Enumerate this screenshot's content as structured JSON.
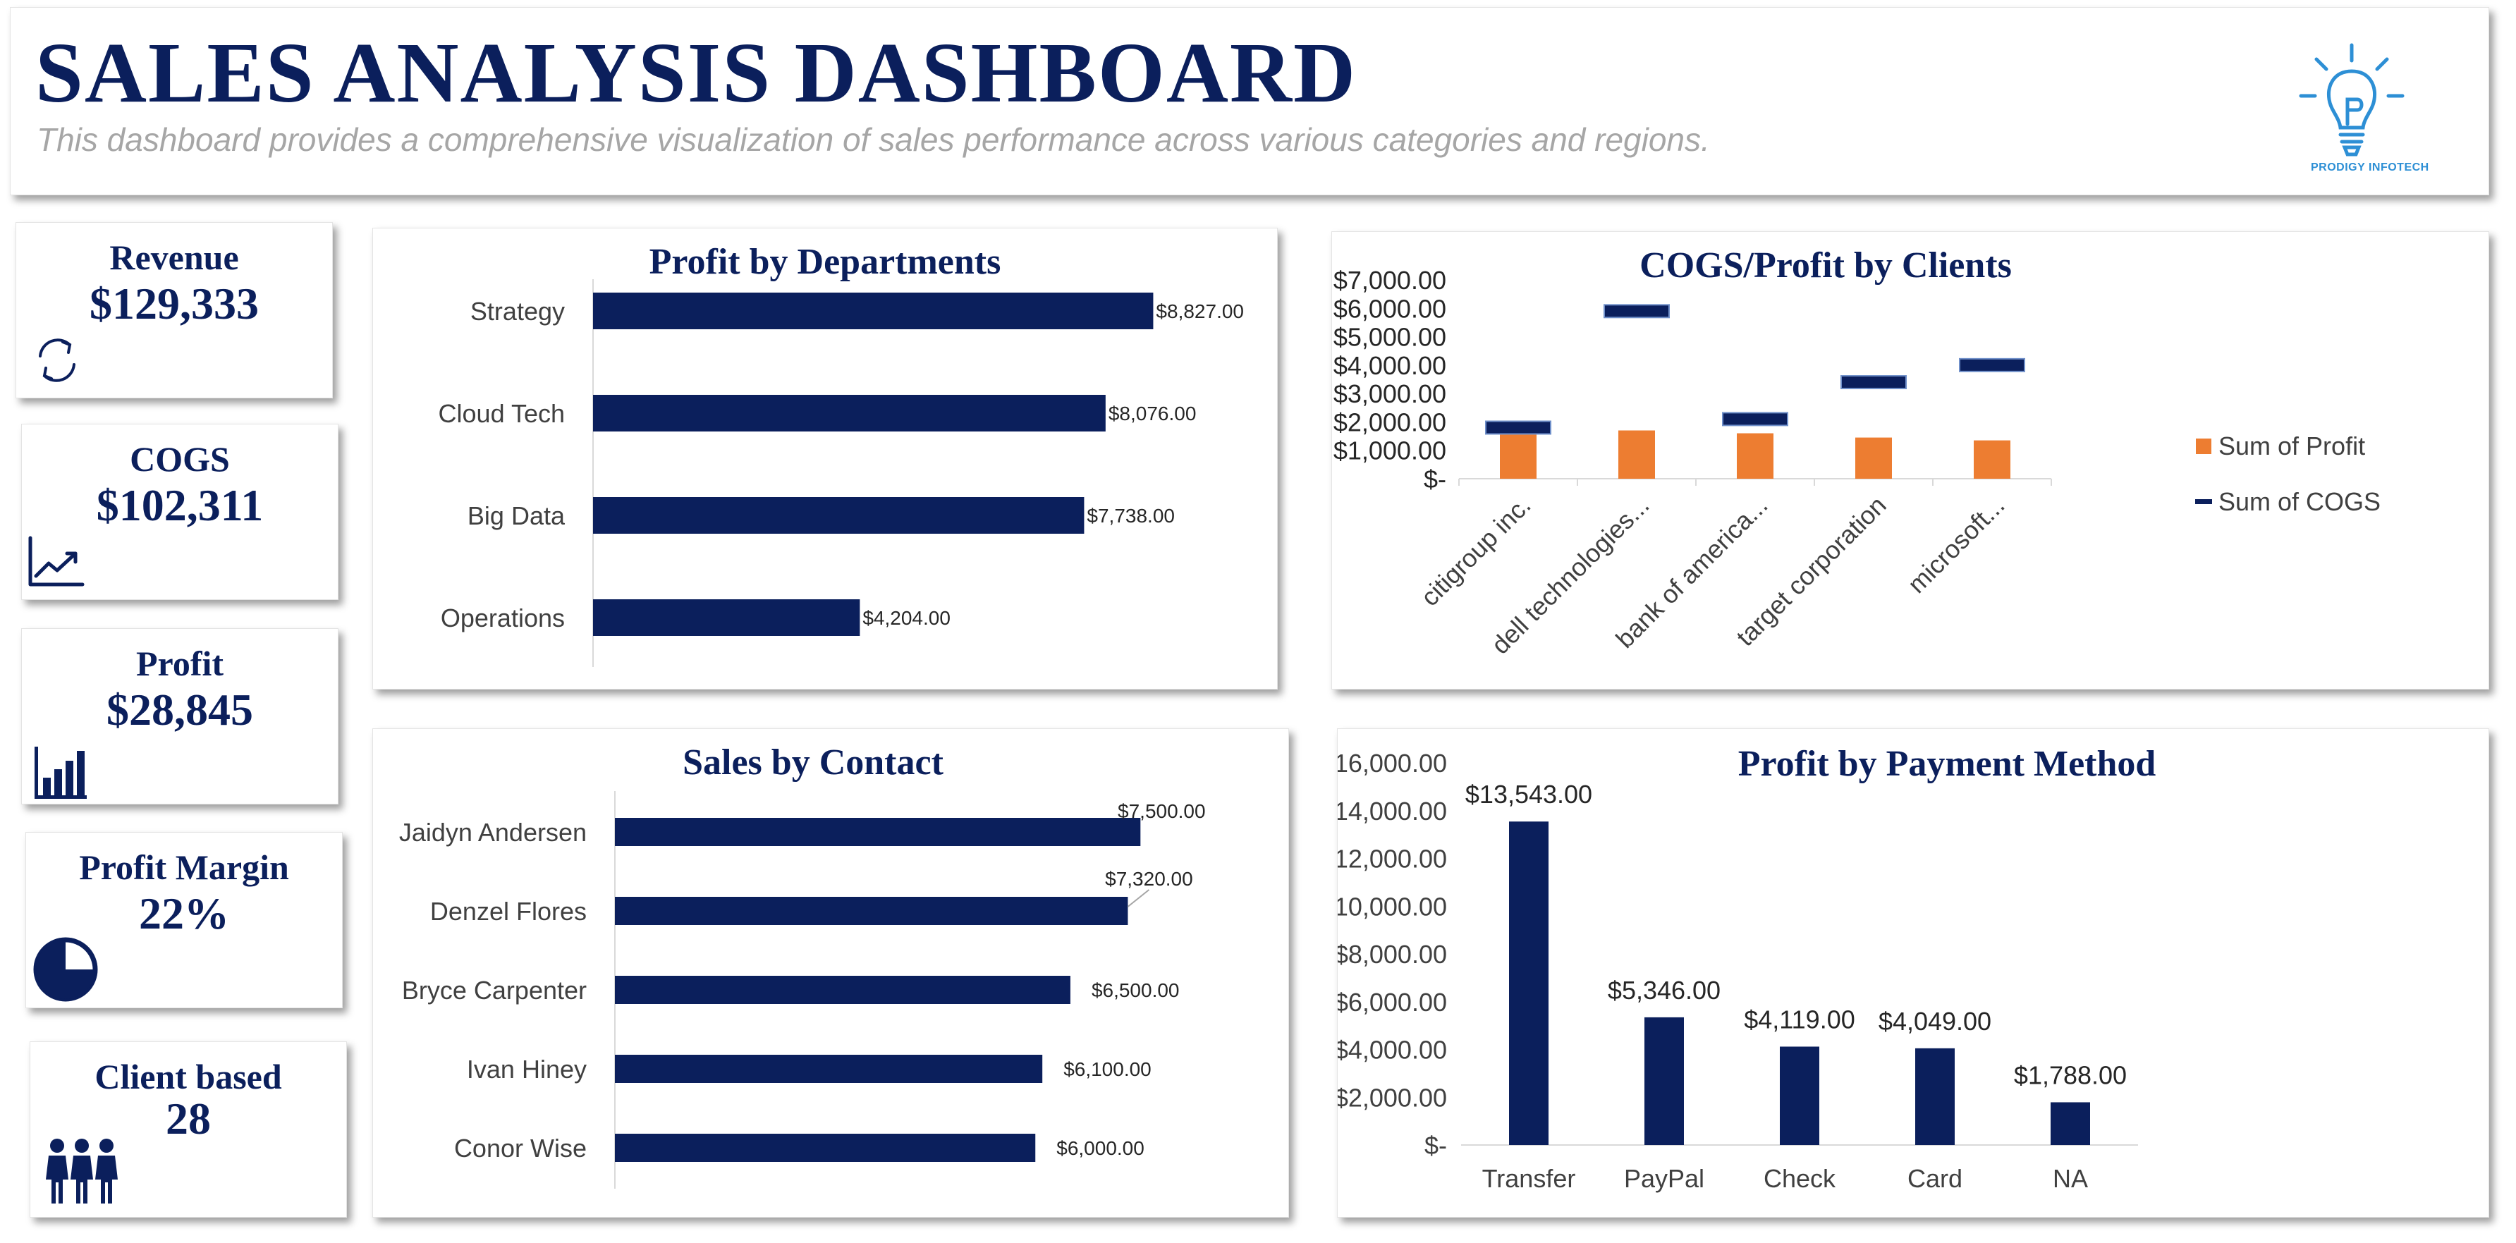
{
  "header": {
    "title": "SALES ANALYSIS DASHBOARD",
    "subtitle": "This dashboard provides a comprehensive visualization of sales performance across various categories and regions.",
    "logo_text": "PRODIGY INFOTECH"
  },
  "kpis": [
    {
      "label": "Revenue",
      "value": "$129,333",
      "icon": "refresh-icon"
    },
    {
      "label": "COGS",
      "value": "$102,311",
      "icon": "trend-up-icon"
    },
    {
      "label": "Profit",
      "value": "$28,845",
      "icon": "bar-chart-icon"
    },
    {
      "label": "Profit Margin",
      "value": "22%",
      "icon": "pie-icon"
    },
    {
      "label": "Client based",
      "value": "28",
      "icon": "people-icon"
    }
  ],
  "colors": {
    "navy": "#0b1f5c",
    "orange": "#ed7d31",
    "grey_text": "#a6a6a6"
  },
  "chart_data": [
    {
      "id": "departments",
      "type": "bar",
      "orientation": "horizontal",
      "title": "Profit by Departments",
      "categories": [
        "Strategy",
        "Cloud Tech",
        "Big Data",
        "Operations"
      ],
      "values": [
        8827,
        8076,
        7738,
        4204
      ],
      "labels": [
        "$8,827.00",
        "$8,076.00",
        "$7,738.00",
        "$4,204.00"
      ],
      "xlim": [
        0,
        9000
      ],
      "color": "#0b1f5c"
    },
    {
      "id": "clients",
      "type": "bar",
      "title": "COGS/Profit by Clients",
      "categories": [
        "citigroup inc.",
        "dell technologies...",
        "bank of america...",
        "target corporation",
        "microsoft..."
      ],
      "series": [
        {
          "name": "Sum of Profit",
          "values": [
            1650,
            1700,
            1600,
            1450,
            1350
          ],
          "color": "#ed7d31",
          "mark": "bar"
        },
        {
          "name": "Sum of COGS",
          "values": [
            1800,
            5900,
            2100,
            3400,
            4000
          ],
          "color": "#0b1f5c",
          "mark": "dash"
        }
      ],
      "ylim": [
        0,
        7000
      ],
      "yticks": [
        "$-",
        "$1,000.00",
        "$2,000.00",
        "$3,000.00",
        "$4,000.00",
        "$5,000.00",
        "$6,000.00",
        "$7,000.00"
      ],
      "legend": "right"
    },
    {
      "id": "contacts",
      "type": "bar",
      "orientation": "horizontal",
      "title": "Sales by Contact",
      "categories": [
        "Jaidyn Andersen",
        "Denzel Flores",
        "Bryce Carpenter",
        "Ivan Hiney",
        "Conor Wise"
      ],
      "values": [
        7500,
        7320,
        6500,
        6100,
        6000
      ],
      "labels": [
        "$7,500.00",
        "$7,320.00",
        "$6,500.00",
        "$6,100.00",
        "$6,000.00"
      ],
      "xlim": [
        0,
        8000
      ],
      "color": "#0b1f5c"
    },
    {
      "id": "payment",
      "type": "bar",
      "title": "Profit by Payment Method",
      "categories": [
        "Transfer",
        "PayPal",
        "Check",
        "Card",
        "NA"
      ],
      "values": [
        13543,
        5346,
        4119,
        4049,
        1788
      ],
      "labels": [
        "$13,543.00",
        "$5,346.00",
        "$4,119.00",
        "$4,049.00",
        "$1,788.00"
      ],
      "ylim": [
        0,
        16000
      ],
      "yticks": [
        "$-",
        "$2,000.00",
        "$4,000.00",
        "$6,000.00",
        "$8,000.00",
        "$10,000.00",
        "$12,000.00",
        "$14,000.00",
        "$16,000.00"
      ],
      "color": "#0b1f5c"
    }
  ]
}
